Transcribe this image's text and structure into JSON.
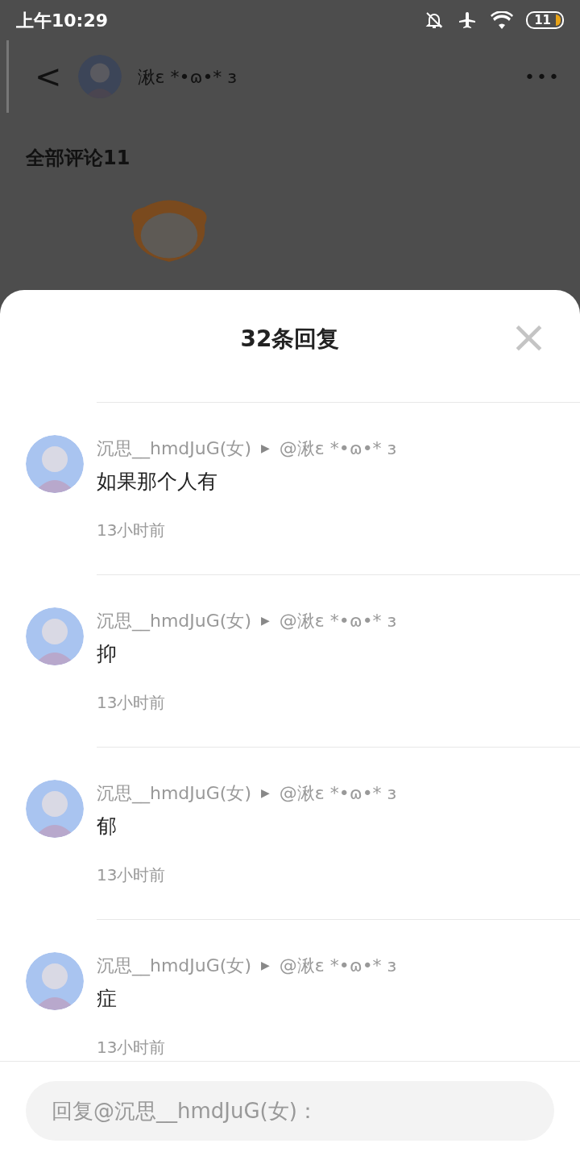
{
  "status_bar": {
    "time": "上午10:29",
    "battery": "11"
  },
  "header": {
    "back": "<",
    "user_name": "湫ɛ *•ɷ•* ɜ",
    "more": "•••"
  },
  "page": {
    "comments_title": "全部评论11"
  },
  "sheet": {
    "title": "32条回复",
    "close": "×"
  },
  "replies": [
    {
      "author": "沉思__hmdJuG(女)",
      "arrow": "▶",
      "target": "@湫ɛ *•ɷ•* ɜ",
      "text": "如果那个人有",
      "time": "13小时前"
    },
    {
      "author": "沉思__hmdJuG(女)",
      "arrow": "▶",
      "target": "@湫ɛ *•ɷ•* ɜ",
      "text": "抑",
      "time": "13小时前"
    },
    {
      "author": "沉思__hmdJuG(女)",
      "arrow": "▶",
      "target": "@湫ɛ *•ɷ•* ɜ",
      "text": "郁",
      "time": "13小时前"
    },
    {
      "author": "沉思__hmdJuG(女)",
      "arrow": "▶",
      "target": "@湫ɛ *•ɷ•* ɜ",
      "text": "症",
      "time": "13小时前"
    }
  ],
  "reply_box": {
    "placeholder": "回复@沉思__hmdJuG(女)："
  }
}
